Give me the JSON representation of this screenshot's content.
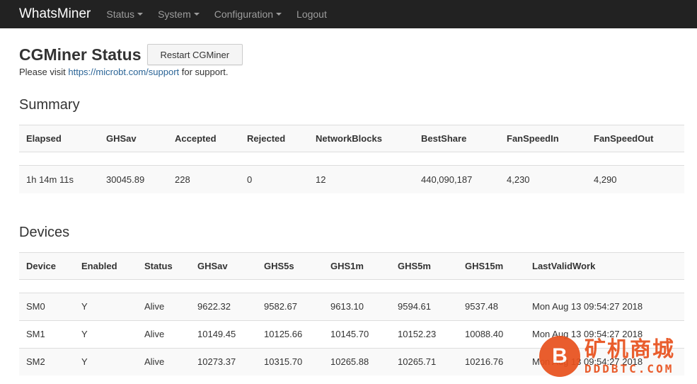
{
  "navbar": {
    "brand": "WhatsMiner",
    "items": [
      {
        "label": "Status",
        "dropdown": true
      },
      {
        "label": "System",
        "dropdown": true
      },
      {
        "label": "Configuration",
        "dropdown": true
      },
      {
        "label": "Logout",
        "dropdown": false
      }
    ]
  },
  "header": {
    "title": "CGMiner Status",
    "restart_label": "Restart CGMiner",
    "visit_prefix": "Please visit ",
    "visit_link": "https://microbt.com/support",
    "visit_suffix": " for support."
  },
  "summary": {
    "heading": "Summary",
    "columns": [
      "Elapsed",
      "GHSav",
      "Accepted",
      "Rejected",
      "NetworkBlocks",
      "BestShare",
      "FanSpeedIn",
      "FanSpeedOut"
    ],
    "row": [
      "1h 14m 11s",
      "30045.89",
      "228",
      "0",
      "12",
      "440,090,187",
      "4,230",
      "4,290"
    ]
  },
  "devices": {
    "heading": "Devices",
    "columns": [
      "Device",
      "Enabled",
      "Status",
      "GHSav",
      "GHS5s",
      "GHS1m",
      "GHS5m",
      "GHS15m",
      "LastValidWork"
    ],
    "rows": [
      [
        "SM0",
        "Y",
        "Alive",
        "9622.32",
        "9582.67",
        "9613.10",
        "9594.61",
        "9537.48",
        "Mon Aug 13 09:54:27 2018"
      ],
      [
        "SM1",
        "Y",
        "Alive",
        "10149.45",
        "10125.66",
        "10145.70",
        "10152.23",
        "10088.40",
        "Mon Aug 13 09:54:27 2018"
      ],
      [
        "SM2",
        "Y",
        "Alive",
        "10273.37",
        "10315.70",
        "10265.88",
        "10265.71",
        "10216.76",
        "Mon Aug 13 09:54:27 2018"
      ]
    ]
  },
  "watermark": {
    "logo_glyph": "B",
    "text_cn": "矿机商城",
    "text_en": "DDDBTC.COM"
  },
  "colors": {
    "navbar_bg": "#222222",
    "link": "#2a6496",
    "watermark": "#e8501c"
  }
}
